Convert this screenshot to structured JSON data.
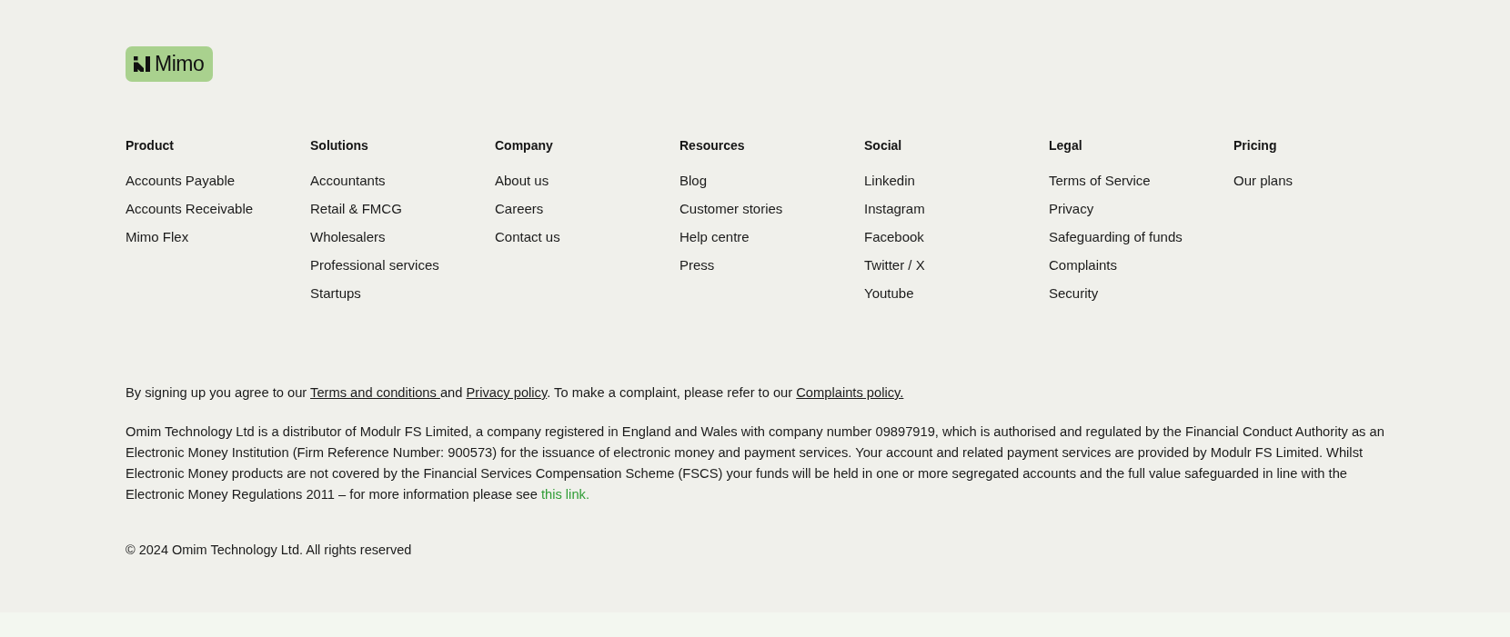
{
  "logo": {
    "text": "Mimo"
  },
  "columns": [
    {
      "heading": "Product",
      "links": [
        "Accounts Payable",
        "Accounts Receivable",
        "Mimo Flex"
      ]
    },
    {
      "heading": "Solutions",
      "links": [
        "Accountants",
        "Retail & FMCG",
        "Wholesalers",
        "Professional services",
        "Startups"
      ]
    },
    {
      "heading": "Company",
      "links": [
        "About us",
        "Careers",
        "Contact us"
      ]
    },
    {
      "heading": "Resources",
      "links": [
        "Blog",
        "Customer stories",
        "Help centre",
        "Press"
      ]
    },
    {
      "heading": "Social",
      "links": [
        "Linkedin",
        "Instagram",
        "Facebook",
        "Twitter / X",
        "Youtube"
      ]
    },
    {
      "heading": "Legal",
      "links": [
        "Terms of Service",
        "Privacy",
        "Safeguarding of funds",
        "Complaints",
        "Security"
      ]
    },
    {
      "heading": "Pricing",
      "links": [
        "Our plans"
      ]
    }
  ],
  "consent": [
    {
      "kind": "text",
      "text": "By signing up you agree to our "
    },
    {
      "kind": "link",
      "text": "Terms and conditions "
    },
    {
      "kind": "text",
      "text": "and "
    },
    {
      "kind": "link",
      "text": "Privacy policy"
    },
    {
      "kind": "text",
      "text": ". To make a complaint, please refer to our "
    },
    {
      "kind": "link",
      "text": "Complaints policy."
    }
  ],
  "disclaimer": [
    {
      "kind": "text",
      "text": "Omim Technology Ltd is a distributor of Modulr FS Limited, a company registered in England and Wales with company number 09897919, which is authorised and regulated by the Financial Conduct Authority as an Electronic Money Institution (Firm Reference Number: 900573) for the issuance of electronic money and payment services. Your account and related payment services are provided by Modulr FS Limited. Whilst Electronic Money products are not covered by the Financial Services Compensation Scheme (FSCS) your funds will be held in one or more segregated accounts and the full value safeguarded in line with the Electronic Money Regulations 2011 – for more information please see "
    },
    {
      "kind": "accent-link",
      "text": "this link."
    }
  ],
  "copyright": "© 2024 Omim Technology Ltd. All rights reserved"
}
